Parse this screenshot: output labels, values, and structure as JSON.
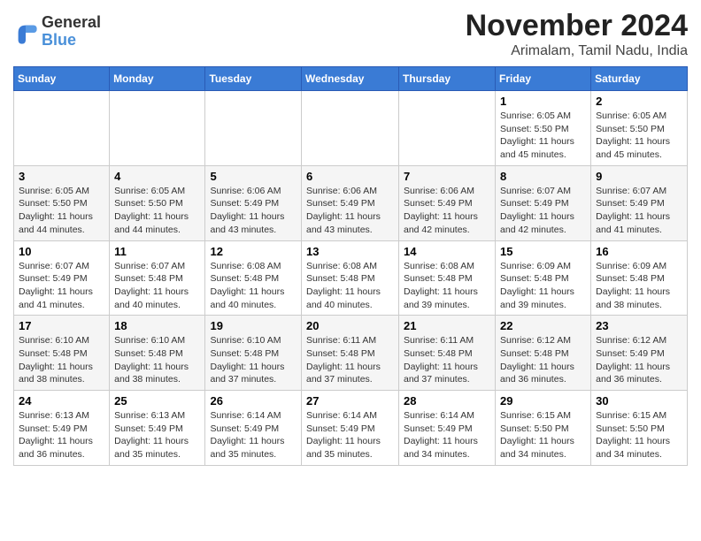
{
  "logo": {
    "general": "General",
    "blue": "Blue"
  },
  "title": "November 2024",
  "subtitle": "Arimalam, Tamil Nadu, India",
  "days_of_week": [
    "Sunday",
    "Monday",
    "Tuesday",
    "Wednesday",
    "Thursday",
    "Friday",
    "Saturday"
  ],
  "weeks": [
    [
      {
        "day": "",
        "info": ""
      },
      {
        "day": "",
        "info": ""
      },
      {
        "day": "",
        "info": ""
      },
      {
        "day": "",
        "info": ""
      },
      {
        "day": "",
        "info": ""
      },
      {
        "day": "1",
        "info": "Sunrise: 6:05 AM\nSunset: 5:50 PM\nDaylight: 11 hours and 45 minutes."
      },
      {
        "day": "2",
        "info": "Sunrise: 6:05 AM\nSunset: 5:50 PM\nDaylight: 11 hours and 45 minutes."
      }
    ],
    [
      {
        "day": "3",
        "info": "Sunrise: 6:05 AM\nSunset: 5:50 PM\nDaylight: 11 hours and 44 minutes."
      },
      {
        "day": "4",
        "info": "Sunrise: 6:05 AM\nSunset: 5:50 PM\nDaylight: 11 hours and 44 minutes."
      },
      {
        "day": "5",
        "info": "Sunrise: 6:06 AM\nSunset: 5:49 PM\nDaylight: 11 hours and 43 minutes."
      },
      {
        "day": "6",
        "info": "Sunrise: 6:06 AM\nSunset: 5:49 PM\nDaylight: 11 hours and 43 minutes."
      },
      {
        "day": "7",
        "info": "Sunrise: 6:06 AM\nSunset: 5:49 PM\nDaylight: 11 hours and 42 minutes."
      },
      {
        "day": "8",
        "info": "Sunrise: 6:07 AM\nSunset: 5:49 PM\nDaylight: 11 hours and 42 minutes."
      },
      {
        "day": "9",
        "info": "Sunrise: 6:07 AM\nSunset: 5:49 PM\nDaylight: 11 hours and 41 minutes."
      }
    ],
    [
      {
        "day": "10",
        "info": "Sunrise: 6:07 AM\nSunset: 5:49 PM\nDaylight: 11 hours and 41 minutes."
      },
      {
        "day": "11",
        "info": "Sunrise: 6:07 AM\nSunset: 5:48 PM\nDaylight: 11 hours and 40 minutes."
      },
      {
        "day": "12",
        "info": "Sunrise: 6:08 AM\nSunset: 5:48 PM\nDaylight: 11 hours and 40 minutes."
      },
      {
        "day": "13",
        "info": "Sunrise: 6:08 AM\nSunset: 5:48 PM\nDaylight: 11 hours and 40 minutes."
      },
      {
        "day": "14",
        "info": "Sunrise: 6:08 AM\nSunset: 5:48 PM\nDaylight: 11 hours and 39 minutes."
      },
      {
        "day": "15",
        "info": "Sunrise: 6:09 AM\nSunset: 5:48 PM\nDaylight: 11 hours and 39 minutes."
      },
      {
        "day": "16",
        "info": "Sunrise: 6:09 AM\nSunset: 5:48 PM\nDaylight: 11 hours and 38 minutes."
      }
    ],
    [
      {
        "day": "17",
        "info": "Sunrise: 6:10 AM\nSunset: 5:48 PM\nDaylight: 11 hours and 38 minutes."
      },
      {
        "day": "18",
        "info": "Sunrise: 6:10 AM\nSunset: 5:48 PM\nDaylight: 11 hours and 38 minutes."
      },
      {
        "day": "19",
        "info": "Sunrise: 6:10 AM\nSunset: 5:48 PM\nDaylight: 11 hours and 37 minutes."
      },
      {
        "day": "20",
        "info": "Sunrise: 6:11 AM\nSunset: 5:48 PM\nDaylight: 11 hours and 37 minutes."
      },
      {
        "day": "21",
        "info": "Sunrise: 6:11 AM\nSunset: 5:48 PM\nDaylight: 11 hours and 37 minutes."
      },
      {
        "day": "22",
        "info": "Sunrise: 6:12 AM\nSunset: 5:48 PM\nDaylight: 11 hours and 36 minutes."
      },
      {
        "day": "23",
        "info": "Sunrise: 6:12 AM\nSunset: 5:49 PM\nDaylight: 11 hours and 36 minutes."
      }
    ],
    [
      {
        "day": "24",
        "info": "Sunrise: 6:13 AM\nSunset: 5:49 PM\nDaylight: 11 hours and 36 minutes."
      },
      {
        "day": "25",
        "info": "Sunrise: 6:13 AM\nSunset: 5:49 PM\nDaylight: 11 hours and 35 minutes."
      },
      {
        "day": "26",
        "info": "Sunrise: 6:14 AM\nSunset: 5:49 PM\nDaylight: 11 hours and 35 minutes."
      },
      {
        "day": "27",
        "info": "Sunrise: 6:14 AM\nSunset: 5:49 PM\nDaylight: 11 hours and 35 minutes."
      },
      {
        "day": "28",
        "info": "Sunrise: 6:14 AM\nSunset: 5:49 PM\nDaylight: 11 hours and 34 minutes."
      },
      {
        "day": "29",
        "info": "Sunrise: 6:15 AM\nSunset: 5:50 PM\nDaylight: 11 hours and 34 minutes."
      },
      {
        "day": "30",
        "info": "Sunrise: 6:15 AM\nSunset: 5:50 PM\nDaylight: 11 hours and 34 minutes."
      }
    ]
  ]
}
